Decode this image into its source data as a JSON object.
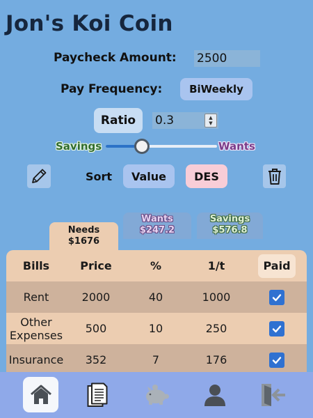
{
  "app": {
    "title": "Jon's Koi Coin"
  },
  "paycheck": {
    "label": "Paycheck Amount:",
    "value": "2500"
  },
  "frequency": {
    "label": "Pay Frequency:",
    "value": "BiWeekly"
  },
  "ratio": {
    "label": "Ratio",
    "value": "0.3"
  },
  "slider": {
    "left_label": "Savings",
    "right_label": "Wants",
    "value": 0.3
  },
  "sort": {
    "label": "Sort",
    "field": "Value",
    "direction": "DES"
  },
  "tabs": [
    {
      "name": "Needs",
      "amount": "$1676",
      "active": true
    },
    {
      "name": "Wants",
      "amount": "$247.2",
      "active": false
    },
    {
      "name": "Savings",
      "amount": "$576.8",
      "active": false
    }
  ],
  "table": {
    "headers": [
      "Bills",
      "Price",
      "%",
      "1/t",
      "Paid"
    ],
    "rows": [
      {
        "bill": "Rent",
        "price": "2000",
        "percent": "40",
        "per_period": "1000",
        "paid": true
      },
      {
        "bill": "Other Expenses",
        "price": "500",
        "percent": "10",
        "per_period": "250",
        "paid": true
      },
      {
        "bill": "Insurance",
        "price": "352",
        "percent": "7",
        "per_period": "176",
        "paid": true
      }
    ]
  },
  "nav": [
    {
      "icon": "home-icon",
      "active": true
    },
    {
      "icon": "document-icon",
      "active": false
    },
    {
      "icon": "piggy-bank-icon",
      "active": false
    },
    {
      "icon": "user-icon",
      "active": false
    },
    {
      "icon": "logout-icon",
      "active": false
    }
  ],
  "colors": {
    "background": "#74ace0",
    "needs_tab": "#eccdb1",
    "checkbox": "#2f71d1",
    "nav_bar": "#8fa9e9"
  }
}
